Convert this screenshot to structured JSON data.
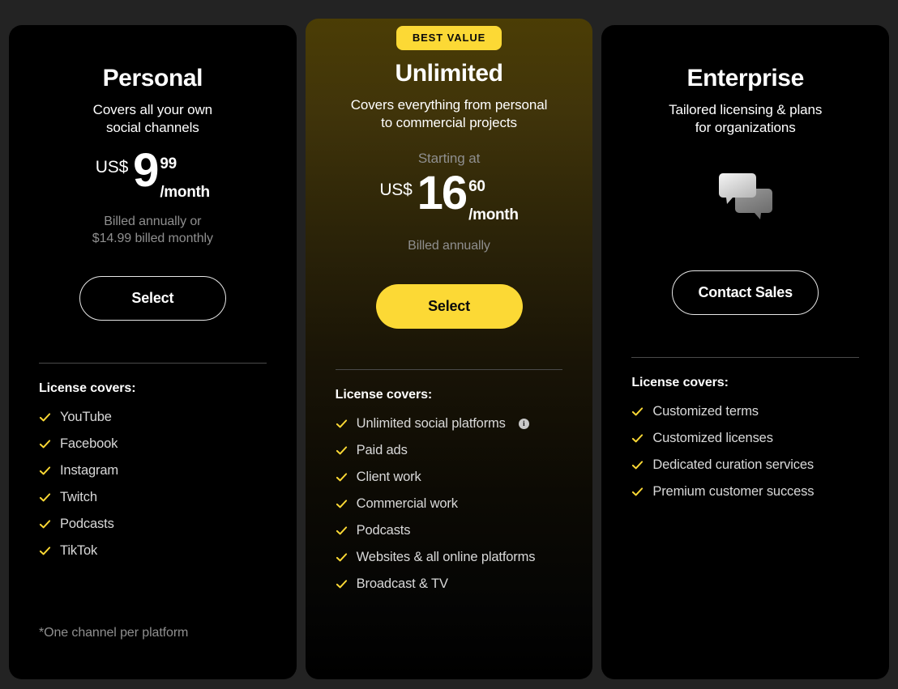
{
  "badge": {
    "label": "BEST VALUE"
  },
  "colors": {
    "page_background": "#232323",
    "card_background": "#000000",
    "accent_yellow": "#fcd935",
    "featured_gradient_top": "#4b3d05",
    "muted_text": "#8f8f8f",
    "feature_text": "#d9d9d9"
  },
  "plans": [
    {
      "name": "Personal",
      "tagline": "Covers all your own\nsocial channels",
      "tagline_line1": "Covers all your own",
      "tagline_line2": "social channels",
      "price": {
        "currency": "US$",
        "amount": "9",
        "cents": "99",
        "period": "/month"
      },
      "billing_note_line1": "Billed annually or",
      "billing_note_line2": "$14.99 billed monthly",
      "cta": {
        "label": "Select",
        "style": "outline"
      },
      "features_title": "License covers:",
      "features": [
        {
          "label": "YouTube"
        },
        {
          "label": "Facebook"
        },
        {
          "label": "Instagram"
        },
        {
          "label": "Twitch"
        },
        {
          "label": "Podcasts"
        },
        {
          "label": "TikTok"
        }
      ],
      "footnote": "*One channel per platform"
    },
    {
      "name": "Unlimited",
      "tagline_line1": "Covers everything from personal",
      "tagline_line2": "to commercial projects",
      "starting_at": "Starting at",
      "price": {
        "currency": "US$",
        "amount": "16",
        "cents": "60",
        "period": "/month"
      },
      "billing_note_line1": "Billed annually",
      "cta": {
        "label": "Select",
        "style": "solid"
      },
      "features_title": "License covers:",
      "features": [
        {
          "label": "Unlimited social platforms",
          "info": "i"
        },
        {
          "label": "Paid ads"
        },
        {
          "label": "Client work"
        },
        {
          "label": "Commercial work"
        },
        {
          "label": "Podcasts"
        },
        {
          "label": "Websites & all online platforms"
        },
        {
          "label": "Broadcast & TV"
        }
      ]
    },
    {
      "name": "Enterprise",
      "tagline_line1": "Tailored licensing & plans",
      "tagline_line2": "for organizations",
      "icon": "chat-bubbles-icon",
      "cta": {
        "label": "Contact Sales",
        "style": "outline"
      },
      "features_title": "License covers:",
      "features": [
        {
          "label": "Customized terms"
        },
        {
          "label": "Customized licenses"
        },
        {
          "label": "Dedicated curation services"
        },
        {
          "label": "Premium customer success"
        }
      ]
    }
  ]
}
